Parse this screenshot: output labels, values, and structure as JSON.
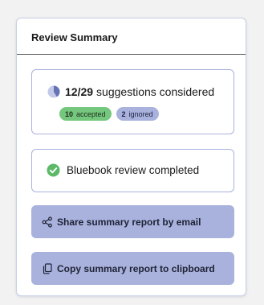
{
  "panel": {
    "title": "Review Summary"
  },
  "suggestions": {
    "considered_count": "12/29",
    "label": "suggestions considered",
    "considered_fraction": 0.414,
    "badges": {
      "accepted_count": "10",
      "accepted_label": "accepted",
      "ignored_count": "2",
      "ignored_label": "ignored"
    }
  },
  "status": {
    "text": "Bluebook review completed",
    "icon": "check-circle-icon"
  },
  "actions": {
    "share_label": "Share summary report by email",
    "share_icon": "share-icon",
    "copy_label": "Copy summary report to clipboard",
    "copy_icon": "copy-icon"
  },
  "colors": {
    "accent": "#a9b2dc",
    "pie_fill": "#6673b3",
    "pie_bg": "#c3c9e8",
    "success": "#74c77c",
    "check": "#5cb968"
  }
}
